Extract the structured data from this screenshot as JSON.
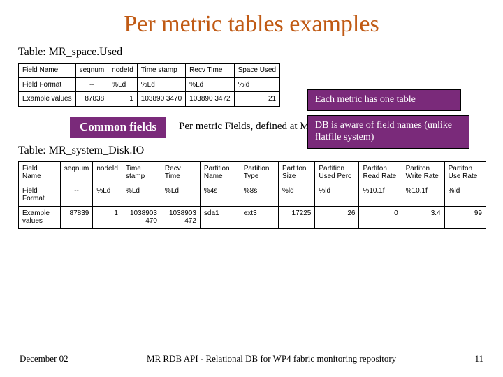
{
  "title": "Per metric tables examples",
  "table1": {
    "label": "Table: MR_space.Used",
    "rows": {
      "r0c0": "Field Name",
      "r0c1": "seqnum",
      "r0c2": "nodeId",
      "r0c3": "Time stamp",
      "r0c4": "Recv Time",
      "r0c5": "Space Used",
      "r1c0": "Field Format",
      "r1c1": "--",
      "r1c2": "%Ld",
      "r1c3": "%Ld",
      "r1c4": "%Ld",
      "r1c5": "%ld",
      "r2c0": "Example values",
      "r2c1": "87838",
      "r2c2": "1",
      "r2c3": "103890 3470",
      "r2c4": "103890 3472",
      "r2c5": "21"
    }
  },
  "callout1": "Each metric has one table",
  "callout2": "DB is aware of field names (unlike flatfile system)",
  "common_fields_label": "Common fields",
  "per_metric_caption": "Per metric Fields, defined at Metric.Class.Def",
  "table2": {
    "label": "Table: MR_system_Disk.IO",
    "rows": {
      "r0c0": "Field Name",
      "r0c1": "seqnum",
      "r0c2": "nodeId",
      "r0c3": "Time stamp",
      "r0c4": "Recv Time",
      "r0c5": "Partition Name",
      "r0c6": "Partition Type",
      "r0c7": "Partiton Size",
      "r0c8": "Partition Used Perc",
      "r0c9": "Partiton Read Rate",
      "r0c10": "Partiton Write Rate",
      "r0c11": "Partiton Use Rate",
      "r1c0": "Field Format",
      "r1c1": "--",
      "r1c2": "%Ld",
      "r1c3": "%Ld",
      "r1c4": "%Ld",
      "r1c5": "%4s",
      "r1c6": "%8s",
      "r1c7": "%ld",
      "r1c8": "%ld",
      "r1c9": "%10.1f",
      "r1c10": "%10.1f",
      "r1c11": "%ld",
      "r2c0": "Example values",
      "r2c1": "87839",
      "r2c2": "1",
      "r2c3": "1038903 470",
      "r2c4": "1038903 472",
      "r2c5": "sda1",
      "r2c6": "ext3",
      "r2c7": "17225",
      "r2c8": "26",
      "r2c9": "0",
      "r2c10": "3.4",
      "r2c11": "99"
    }
  },
  "footer": {
    "left": "December 02",
    "center": "MR RDB API - Relational DB for WP4 fabric monitoring repository",
    "right": "11"
  }
}
